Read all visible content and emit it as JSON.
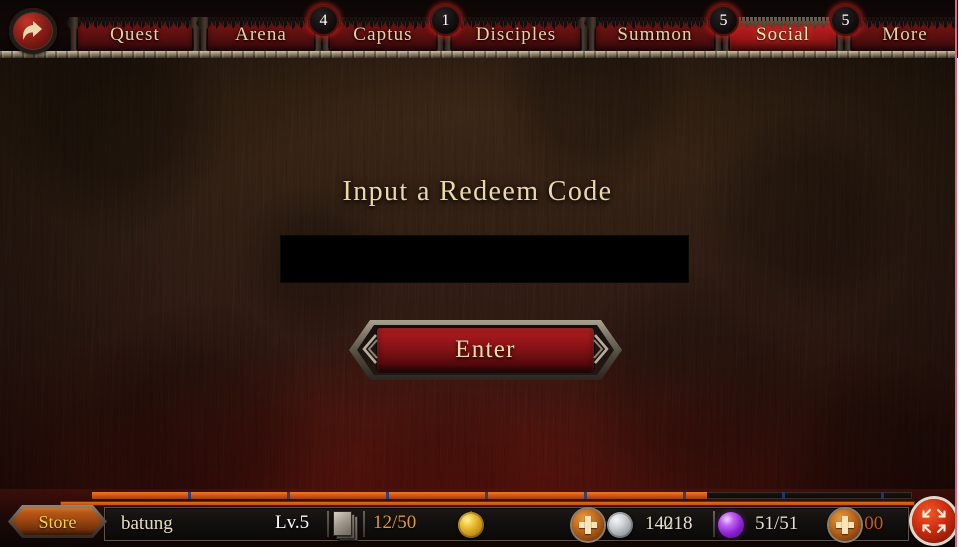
{
  "header": {
    "back_icon": "back-arrow-icon",
    "tabs": [
      {
        "label": "Quest",
        "badge": null,
        "active": false
      },
      {
        "label": "Arena",
        "badge": "4",
        "active": false
      },
      {
        "label": "Captus",
        "badge": "1",
        "active": false
      },
      {
        "label": "Disciples",
        "badge": null,
        "active": false
      },
      {
        "label": "Summon",
        "badge": "5",
        "active": false
      },
      {
        "label": "Social",
        "badge": "5",
        "active": true
      },
      {
        "label": "More",
        "badge": null,
        "active": false
      }
    ]
  },
  "main": {
    "title": "Input a Redeem Code",
    "code_input": {
      "value": "",
      "placeholder": ""
    },
    "enter_label": "Enter"
  },
  "bottom": {
    "store_label": "Store",
    "player_name": "batung",
    "level": "Lv.5",
    "stamina": "12/50",
    "gold": "0",
    "silver": "14218",
    "gems": "51/51",
    "timer": "05:00",
    "xp_percent": 75,
    "icons": {
      "cards": "card-stack-icon",
      "gold": "gold-coin-icon",
      "silver": "silver-coin-icon",
      "gem": "purple-orb-icon",
      "add_gold": "plus-icon",
      "add_gem": "plus-icon",
      "fullscreen": "fullscreen-expand-icon"
    }
  },
  "colors": {
    "accent_red": "#a5191d",
    "gold_text": "#ecd8a6",
    "store_orange": "#c7601a",
    "store_label": "#fcd13f",
    "xp_orange": "#e8741c",
    "timer": "#c9571f",
    "stamina": "#e5972c",
    "badge_glow": "#be1e19",
    "border_pink": "#e0687d"
  }
}
